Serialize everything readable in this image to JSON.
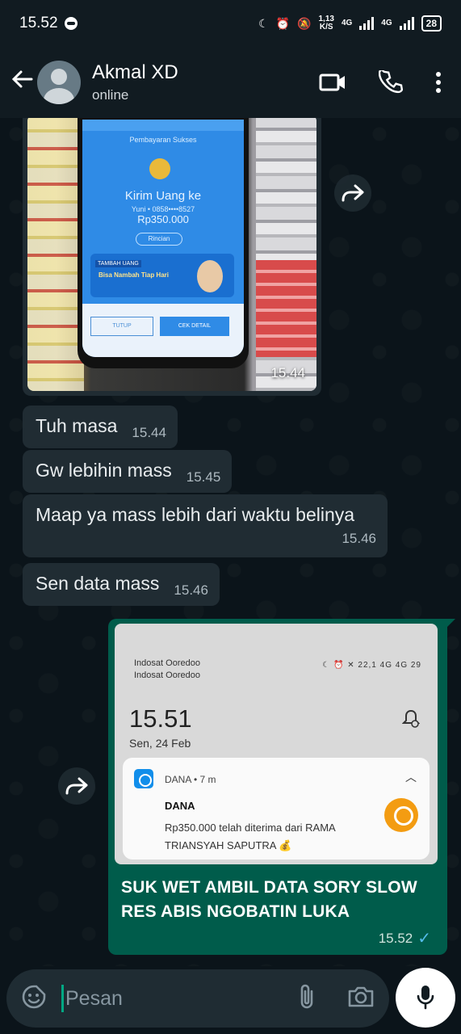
{
  "status_bar": {
    "time": "15.52",
    "net_speed_top": "1,13",
    "net_speed_unit": "K/S",
    "sim1": "4G",
    "sim2": "4G",
    "battery": "28"
  },
  "header": {
    "contact_name": "Akmal XD",
    "contact_status": "online"
  },
  "messages": {
    "image_in": {
      "time": "15.44",
      "photo_text": {
        "caption_small": "Pembayaran Sukses",
        "title": "Kirim Uang ke",
        "sub": "Yuni • 0858••••8527",
        "amount": "Rp350.000",
        "button": "Rincian",
        "banner_tag": "TAMBAH UANG",
        "banner_text": "Bisa Nambah Tiap Hari",
        "btn_left": "TUTUP",
        "btn_right": "CEK DETAIL"
      }
    },
    "texts_in": [
      {
        "text": "Tuh masa",
        "time": "15.44"
      },
      {
        "text": "Gw lebihin mass",
        "time": "15.45"
      },
      {
        "text": "Maap ya mass lebih dari waktu belinya",
        "time": "15.46"
      },
      {
        "text": "Sen data mass",
        "time": "15.46"
      }
    ],
    "image_out": {
      "screenshot": {
        "carrier1": "Indosat Ooredoo",
        "carrier2": "Indosat Ooredoo",
        "status_icons": "☾ ⏰ ✕ 22,1 4G 4G 29",
        "clock": "15.51",
        "date": "Sen, 24 Feb",
        "notif_app": "DANA • 7 m",
        "notif_title": "DANA",
        "notif_body": "Rp350.000 telah diterima dari RAMA TRIANSYAH SAPUTRA 💰"
      },
      "caption": "SUK WET AMBIL DATA SORY SLOW RES ABIS NGOBATIN LUKA",
      "time": "15.52",
      "tick": "✓"
    }
  },
  "input": {
    "placeholder": "Pesan",
    "value": ""
  },
  "colors": {
    "bubble_in": "#202c33",
    "bubble_out": "#005c4b",
    "accent": "#00a884",
    "tick_blue": "#53bdeb"
  }
}
